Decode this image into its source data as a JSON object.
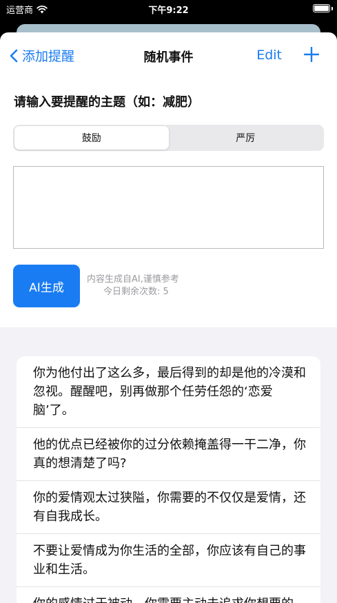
{
  "status_bar": {
    "carrier": "运营商",
    "time": "下午9:22"
  },
  "nav": {
    "back_label": "添加提醒",
    "title": "随机事件",
    "edit_label": "Edit"
  },
  "prompt": "请输入要提醒的主题（如：减肥）",
  "segments": [
    {
      "label": "鼓励",
      "selected": true
    },
    {
      "label": "严厉",
      "selected": false
    }
  ],
  "topic_input": {
    "value": "",
    "placeholder": ""
  },
  "ai": {
    "button_label": "AI生成",
    "note_line1": "内容生成自AI,谨慎参考",
    "note_line2": "今日剩余次数: 5"
  },
  "messages": [
    "你为他付出了这么多，最后得到的却是他的冷漠和忽视。醒醒吧，别再做那个任劳任怨的‘恋爱脑’了。",
    "他的优点已经被你的过分依赖掩盖得一干二净，你真的想清楚了吗?",
    "你的爱情观太过狭隘，你需要的不仅仅是爱情，还有自我成长。",
    "不要让爱情成为你生活的全部，你应该有自己的事业和生活。",
    "你的感情过于被动，你需要主动去追求你想要的。"
  ],
  "colors": {
    "accent": "#1a7cf2",
    "group_bg": "#f2f2f7"
  }
}
